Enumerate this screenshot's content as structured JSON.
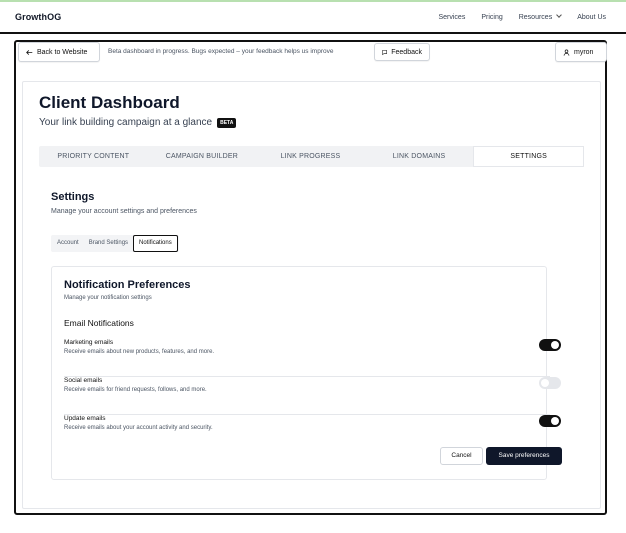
{
  "nav": {
    "brand": "GrowthOG",
    "links": [
      "Services",
      "Pricing",
      "Resources",
      "About Us"
    ]
  },
  "topbar": {
    "back_label": "Back to Website",
    "beta_message": "Beta dashboard in progress. Bugs expected – your feedback helps us improve",
    "feedback_label": "Feedback",
    "user_name": "myron"
  },
  "dashboard": {
    "title": "Client Dashboard",
    "subtitle": "Your link building campaign at a glance",
    "badge": "BETA",
    "tabs": [
      "PRIORITY CONTENT",
      "CAMPAIGN BUILDER",
      "LINK PROGRESS",
      "LINK DOMAINS",
      "SETTINGS"
    ],
    "active_tab": "SETTINGS"
  },
  "settings": {
    "title": "Settings",
    "subtitle": "Manage your account settings and preferences",
    "subtabs": [
      "Account",
      "Brand Settings",
      "Notifications"
    ],
    "active_subtab": "Notifications"
  },
  "notifications": {
    "title": "Notification Preferences",
    "subtitle": "Manage your notification settings",
    "section": "Email Notifications",
    "items": [
      {
        "label": "Marketing emails",
        "desc": "Receive emails about new products, features, and more.",
        "enabled": true
      },
      {
        "label": "Social emails",
        "desc": "Receive emails for friend requests, follows, and more.",
        "enabled": false
      },
      {
        "label": "Update emails",
        "desc": "Receive emails about your account activity and security.",
        "enabled": true
      }
    ],
    "cancel_label": "Cancel",
    "save_label": "Save preferences"
  },
  "colors": {
    "accent": "#0f172a",
    "top_line": "#b8e0b0"
  }
}
